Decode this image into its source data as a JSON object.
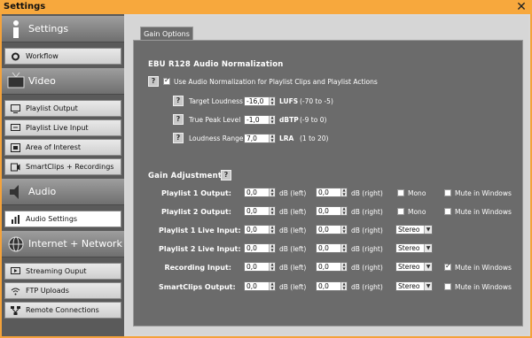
{
  "window": {
    "title": "Settings",
    "close_glyph": "✕"
  },
  "sidebar": {
    "categories": [
      {
        "label": "Settings",
        "icon": "info-icon"
      },
      {
        "label": "Video",
        "icon": "tv-icon"
      },
      {
        "label": "Audio",
        "icon": "speaker-icon"
      },
      {
        "label": "Internet + Network",
        "icon": "globe-icon"
      }
    ],
    "items": [
      {
        "label": "Workflow",
        "icon": "gear-icon"
      },
      {
        "label": "Playlist Output",
        "icon": "monitor-icon"
      },
      {
        "label": "Playlist Live Input",
        "icon": "monitor-in-icon"
      },
      {
        "label": "Area of Interest",
        "icon": "crop-icon"
      },
      {
        "label": "SmartClips + Recordings",
        "icon": "record-icon"
      },
      {
        "label": "Audio Settings",
        "icon": "bars-icon"
      },
      {
        "label": "Streaming Ouput",
        "icon": "stream-icon"
      },
      {
        "label": "FTP Uploads",
        "icon": "wifi-icon"
      },
      {
        "label": "Remote Connections",
        "icon": "network-icon"
      }
    ]
  },
  "main": {
    "tab": "Gain Options",
    "ebu": {
      "heading": "EBU R128 Audio Normalization",
      "help": "?",
      "enable_label": "Use Audio Normalization for Playlist Clips and Playlist Actions",
      "enabled": true,
      "params": [
        {
          "label": "Target Loudness",
          "value": "-16,0",
          "unit": "LUFS",
          "range": "(-70 to -5)"
        },
        {
          "label": "True Peak Level",
          "value": "-1,0",
          "unit": "dBTP",
          "range": "(-9 to 0)"
        },
        {
          "label": "Loudness Range",
          "value": "7,0",
          "unit": "LRA",
          "range": "(1 to 20)"
        }
      ]
    },
    "gain": {
      "heading": "Gain Adjustments",
      "help": "?",
      "left_unit": "dB (left)",
      "right_unit": "dB (right)",
      "rows": [
        {
          "label": "Playlist 1 Output:",
          "left": "0,0",
          "right": "0,0",
          "mode": "Mono",
          "mono_checked": false,
          "mute": "Mute in Windows",
          "mute_checked": false
        },
        {
          "label": "Playlist 2 Output:",
          "left": "0,0",
          "right": "0,0",
          "mode": "Mono",
          "mono_checked": false,
          "mute": "Mute in Windows",
          "mute_checked": false
        },
        {
          "label": "Playlist 1 Live Input:",
          "left": "0,0",
          "right": "0,0",
          "mode": "Stereo",
          "mute": "",
          "mute_checked": false
        },
        {
          "label": "Playlist 2 Live Input:",
          "left": "0,0",
          "right": "0,0",
          "mode": "Stereo",
          "mute": "",
          "mute_checked": false
        },
        {
          "label": "Recording Input:",
          "left": "0,0",
          "right": "0,0",
          "mode": "Stereo",
          "mute": "Mute in Windows",
          "mute_checked": true
        },
        {
          "label": "SmartClips Output:",
          "left": "0,0",
          "right": "0,0",
          "mode": "Stereo",
          "mute": "Mute in Windows",
          "mute_checked": false
        }
      ]
    }
  }
}
